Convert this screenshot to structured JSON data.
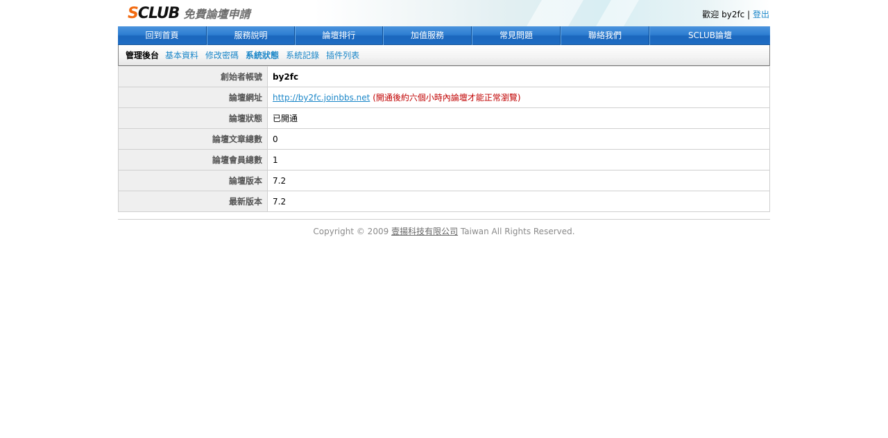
{
  "header": {
    "logo": {
      "s": "S",
      "club": "CLUB",
      "subtitle": "免費論壇申請"
    },
    "welcome": "歡迎",
    "username": "by2fc",
    "separator": "|",
    "logout": "登出"
  },
  "nav": {
    "items": [
      {
        "label": "回到首頁"
      },
      {
        "label": "服務說明"
      },
      {
        "label": "論壇排行"
      },
      {
        "label": "加值服務"
      },
      {
        "label": "常見問題"
      },
      {
        "label": "聯絡我們"
      },
      {
        "label": "SCLUB論壇"
      }
    ]
  },
  "subnav": {
    "title": "管理後台",
    "links": [
      {
        "label": "基本資料"
      },
      {
        "label": "修改密碼"
      },
      {
        "label": "系統狀態"
      },
      {
        "label": "系統記錄"
      },
      {
        "label": "插件列表"
      }
    ]
  },
  "info": {
    "rows": [
      {
        "label": "創始者帳號",
        "value": "by2fc"
      },
      {
        "label": "論壇網址",
        "url": "http://by2fc.joinbbs.net",
        "note": "(開通後約六個小時內論壇才能正常瀏覽)"
      },
      {
        "label": "論壇狀態",
        "value": "已開通"
      },
      {
        "label": "論壇文章總數",
        "value": "0"
      },
      {
        "label": "論壇會員總數",
        "value": "1"
      },
      {
        "label": "論壇版本",
        "value": "7.2"
      },
      {
        "label": "最新版本",
        "value": "7.2"
      }
    ]
  },
  "footer": {
    "prefix": "Copyright © 2009",
    "company": "壹揚科技有限公司",
    "suffix": "Taiwan All Rights Reserved."
  },
  "colors": {
    "accent": "#f26a10",
    "link": "#1a86c8",
    "nav": "#2f7fd2",
    "note": "#c00000"
  }
}
